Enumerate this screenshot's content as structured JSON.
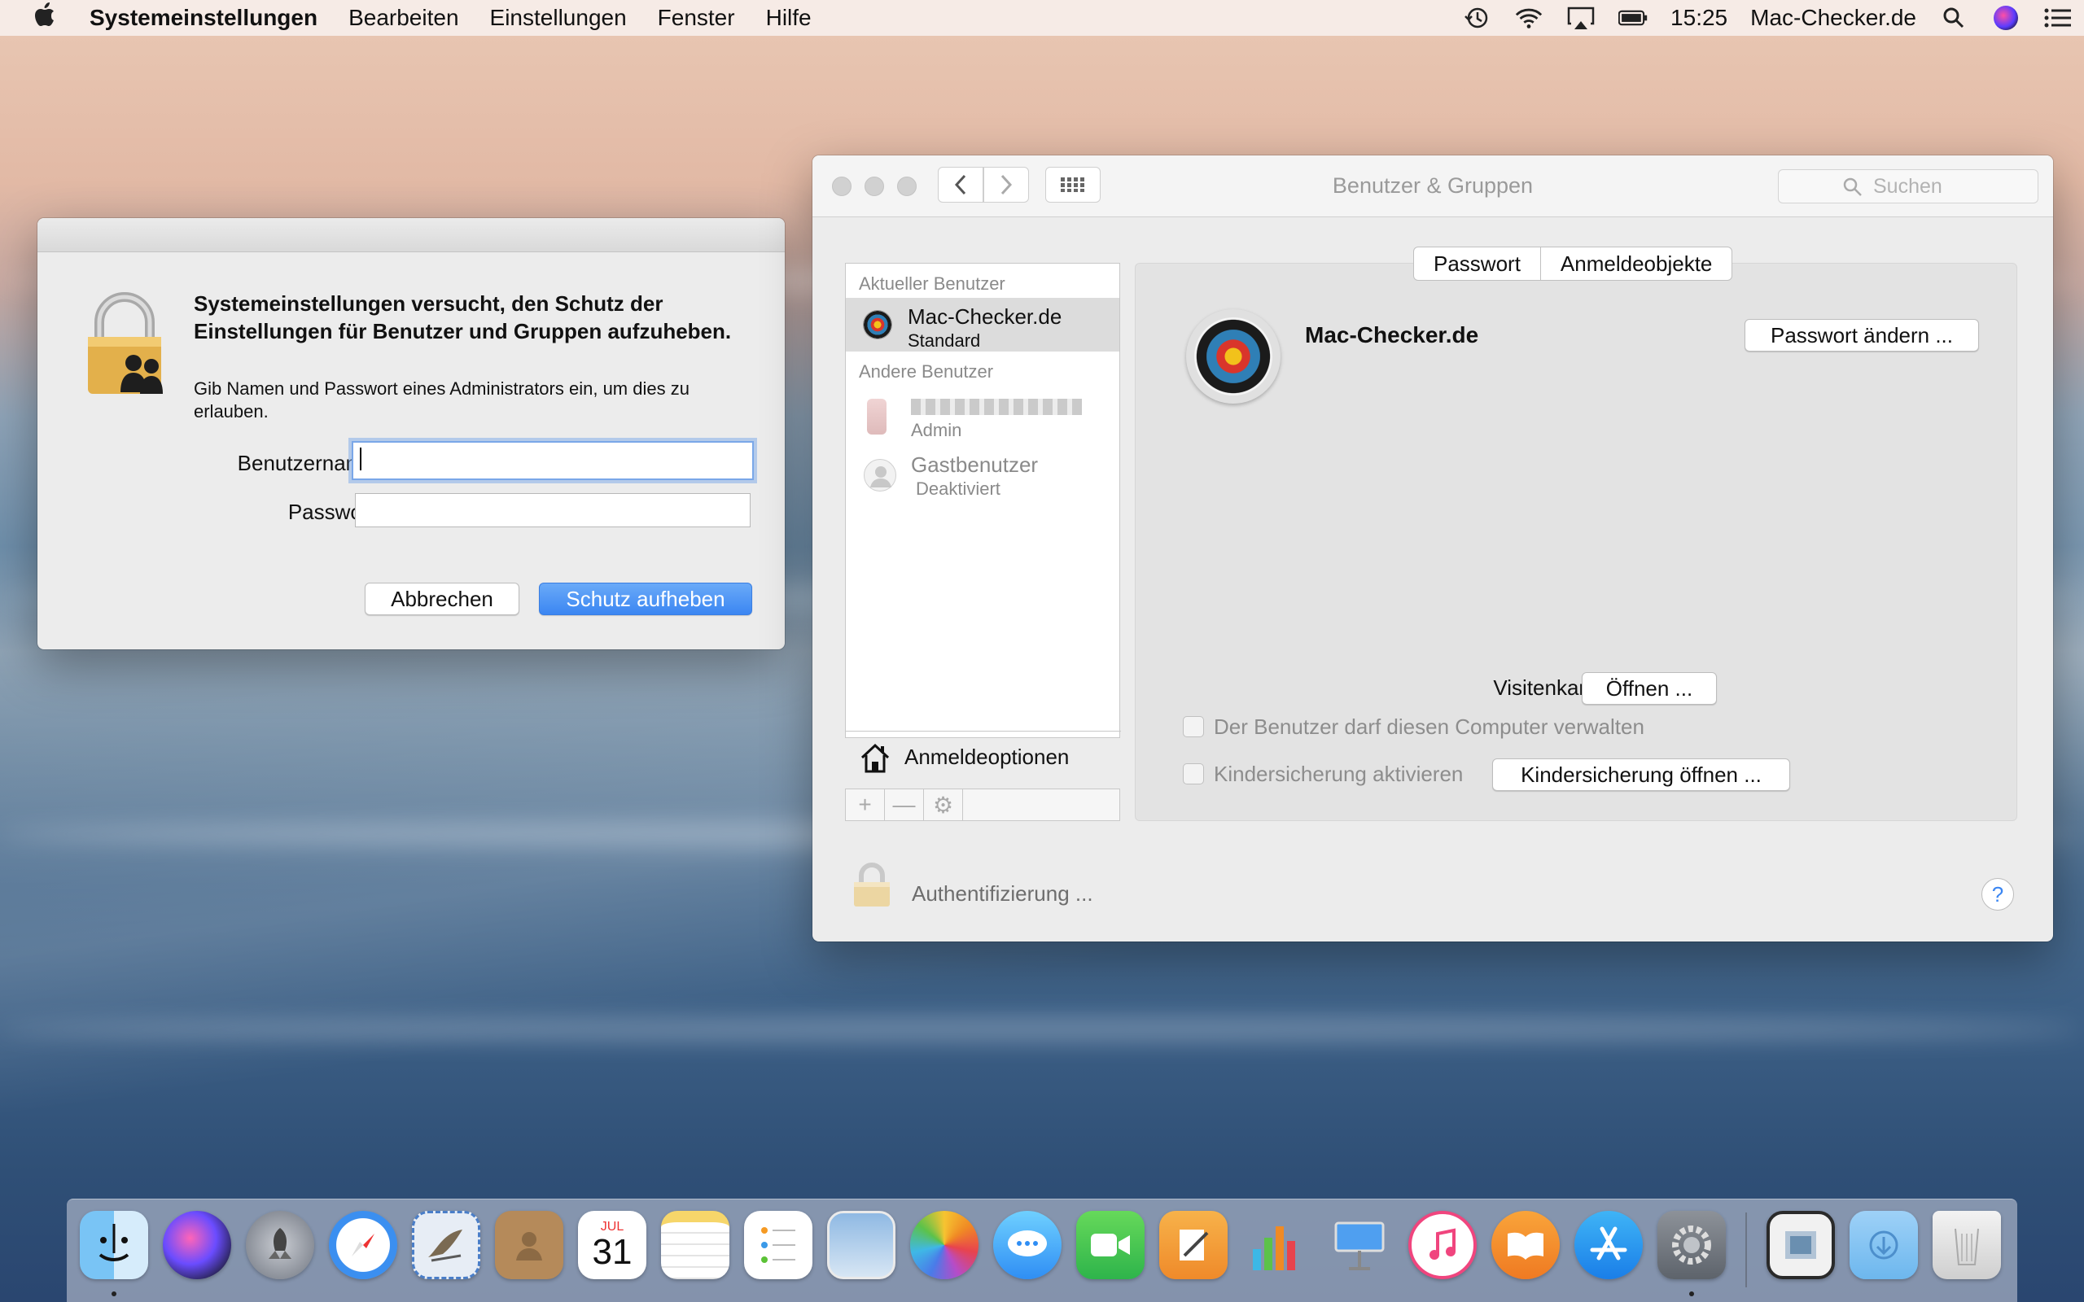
{
  "menubar": {
    "apple_icon": "apple-logo-icon",
    "app_name": "Systemeinstellungen",
    "menus": [
      "Bearbeiten",
      "Einstellungen",
      "Fenster",
      "Hilfe"
    ],
    "clock": "15:25",
    "user": "Mac-Checker.de",
    "status_icons": [
      "time-machine-icon",
      "wifi-icon",
      "airplay-icon",
      "battery-icon",
      "spotlight-search-icon",
      "siri-icon",
      "notification-center-icon"
    ]
  },
  "auth_dialog": {
    "heading": "Systemeinstellungen versucht, den Schutz der Einstellungen für Benutzer und Gruppen aufzuheben.",
    "message": "Gib Namen und Passwort eines Administrators ein, um dies zu erlauben.",
    "username_label": "Benutzername:",
    "username_value": "",
    "password_label": "Passwort:",
    "password_value": "",
    "cancel_label": "Abbrechen",
    "confirm_label": "Schutz aufheben"
  },
  "prefs": {
    "title": "Benutzer & Gruppen",
    "search_placeholder": "Suchen",
    "sidebar": {
      "current_header": "Aktueller Benutzer",
      "current_user": {
        "name": "Mac-Checker.de",
        "role": "Standard"
      },
      "others_header": "Andere Benutzer",
      "other_users": [
        {
          "name": "",
          "role": "Admin"
        },
        {
          "name": "Gastbenutzer",
          "role": "Deaktiviert"
        }
      ],
      "login_options": "Anmeldeoptionen",
      "toolbar": [
        "+",
        "—",
        "⚙"
      ]
    },
    "tabs": [
      "Passwort",
      "Anmeldeobjekte"
    ],
    "user_name": "Mac-Checker.de",
    "change_password": "Passwort ändern ...",
    "contact_label": "Visitenkarte:",
    "contact_button": "Öffnen ...",
    "allow_admin": "Der Benutzer darf diesen Computer verwalten",
    "parental_label": "Kindersicherung aktivieren",
    "parental_button": "Kindersicherung öffnen ...",
    "status": "Authentifizierung ...",
    "help": "?"
  },
  "dock": {
    "apps": [
      "Finder",
      "Siri",
      "Launchpad",
      "Safari",
      "Mail",
      "Kontakte",
      "Kalender",
      "Notizen",
      "Erinnerungen",
      "Fotobooth",
      "Fotos",
      "Nachrichten",
      "FaceTime",
      "Pages",
      "Numbers",
      "Keynote",
      "iTunes",
      "iBooks",
      "App Store",
      "Systemeinstellungen",
      "Vorschau",
      "Downloads",
      "Papierkorb"
    ],
    "calendar_month": "JUL",
    "calendar_day": "31"
  }
}
